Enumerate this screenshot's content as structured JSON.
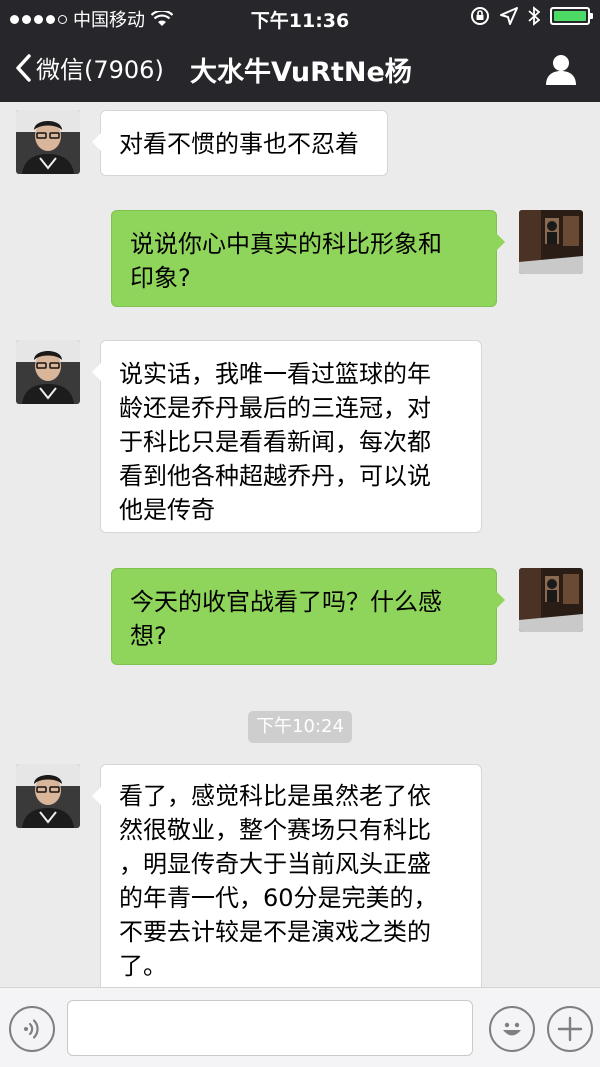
{
  "status_bar": {
    "carrier": "中国移动",
    "time": "下午11:36"
  },
  "nav": {
    "back_label": "微信(7906)",
    "title": "大水牛VuRtNe杨"
  },
  "messages": [
    {
      "side": "received",
      "text": "对看不惯的事也不忍着"
    },
    {
      "side": "sent",
      "lines": [
        "说说你心中真实的科比形象和",
        "印象?"
      ]
    },
    {
      "side": "received",
      "lines": [
        "说实话，我唯一看过篮球的年",
        "龄还是乔丹最后的三连冠，对",
        "于科比只是看看新闻，每次都",
        "看到他各种超越乔丹，可以说",
        "他是传奇"
      ]
    },
    {
      "side": "sent",
      "lines": [
        "今天的收官战看了吗？什么感",
        "想?"
      ]
    },
    {
      "side": "received",
      "lines": [
        "看了，感觉科比是虽然老了依",
        "然很敬业，整个赛场只有科比",
        "，明显传奇大于当前风头正盛",
        "的年青一代，60分是完美的，",
        "不要去计较是不是演戏之类的",
        "了。"
      ]
    }
  ],
  "timestamp": "下午10:24",
  "colors": {
    "header_bg": "#27272b",
    "chat_bg": "#ebebeb",
    "sent_bubble": "#8fd55b",
    "received_bubble": "#ffffff",
    "battery": "#4cd964"
  }
}
